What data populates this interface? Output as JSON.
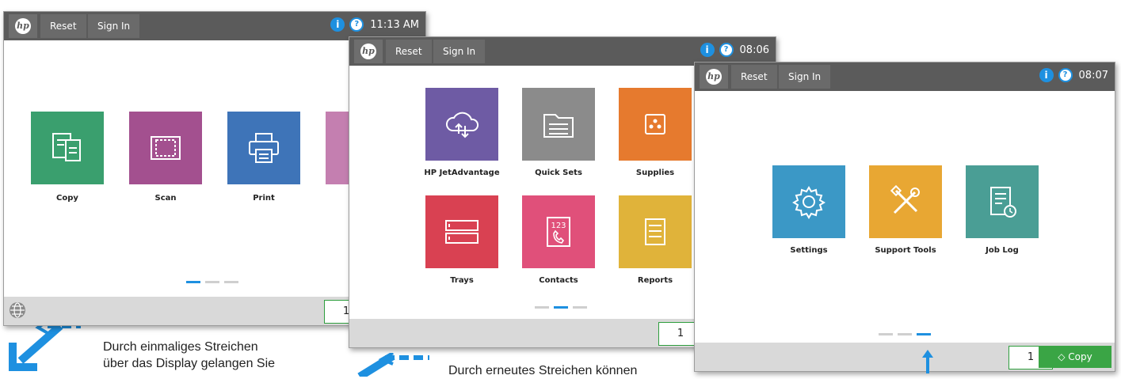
{
  "colors": {
    "accent": "#1e90e0",
    "topbar": "#5b5b5b",
    "green": "#3aa545"
  },
  "panel1": {
    "reset": "Reset",
    "sign_in": "Sign In",
    "time": "11:13 AM",
    "tiles": [
      {
        "label": "Copy",
        "icon": "copy-icon",
        "color": "#3a9f6e"
      },
      {
        "label": "Scan",
        "icon": "scan-icon",
        "color": "#a3508f"
      },
      {
        "label": "Print",
        "icon": "print-icon",
        "color": "#3e74b8"
      }
    ],
    "copies": "1",
    "page_indicator": {
      "pages": 3,
      "active": 1
    }
  },
  "panel2": {
    "reset": "Reset",
    "sign_in": "Sign In",
    "time": "08:06",
    "tiles": [
      {
        "label": "HP JetAdvantage",
        "icon": "cloud-icon",
        "color": "#6e5ba4"
      },
      {
        "label": "Quick Sets",
        "icon": "quick-sets-icon",
        "color": "#8b8b8b"
      },
      {
        "label": "Supplies",
        "icon": "supplies-icon",
        "color": "#e67a2e"
      },
      {
        "label": "Trays",
        "icon": "trays-icon",
        "color": "#d94152"
      },
      {
        "label": "Contacts",
        "icon": "contacts-icon",
        "color": "#e0507a"
      },
      {
        "label": "Reports",
        "icon": "reports-icon",
        "color": "#e0b33a"
      }
    ],
    "copies": "1",
    "page_indicator": {
      "pages": 3,
      "active": 2
    }
  },
  "panel3": {
    "reset": "Reset",
    "sign_in": "Sign In",
    "time": "08:07",
    "tiles": [
      {
        "label": "Settings",
        "icon": "gear-icon",
        "color": "#3b98c6"
      },
      {
        "label": "Support Tools",
        "icon": "tools-icon",
        "color": "#e8a733"
      },
      {
        "label": "Job Log",
        "icon": "job-log-icon",
        "color": "#4a9e95"
      }
    ],
    "copies": "1",
    "copy_button": "Copy",
    "page_indicator": {
      "pages": 3,
      "active": 3
    }
  },
  "captions": {
    "first_line1": "Durch einmaliges Streichen",
    "first_line2": "über  das Display gelangen Sie",
    "second_line1": "Durch erneutes Streichen können"
  }
}
